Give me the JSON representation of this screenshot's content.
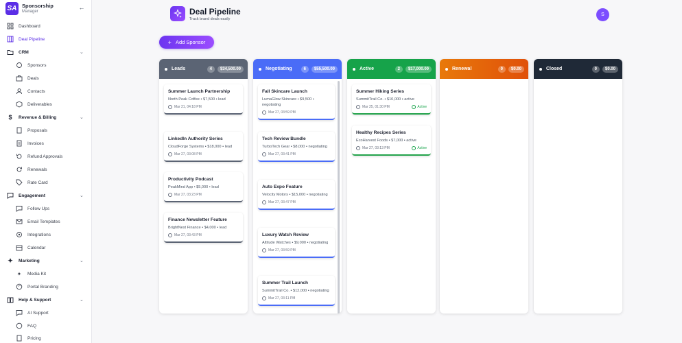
{
  "brand": {
    "logo": "SA",
    "title": "Sponsorship",
    "subtitle": "Manager",
    "collapse_icon": "chevron-left"
  },
  "nav": {
    "dashboard": "Dashboard",
    "deal_pipeline": "Deal Pipeline",
    "crm": "CRM",
    "sponsors": "Sponsors",
    "deals": "Deals",
    "contacts": "Contacts",
    "deliverables": "Deliverables",
    "revenue": "Revenue & Billing",
    "proposals": "Proposals",
    "invoices": "Invoices",
    "refund": "Refund Approvals",
    "renewals": "Renewals",
    "rate_card": "Rate Card",
    "engagement": "Engagement",
    "follow_ups": "Follow Ups",
    "email_templates": "Email Templates",
    "integrations": "Integrations",
    "calendar": "Calendar",
    "marketing": "Marketing",
    "media_kit": "Media Kit",
    "portal_branding": "Portal Branding",
    "help": "Help & Support",
    "ai_support": "AI Support",
    "faq": "FAQ",
    "pricing": "Pricing"
  },
  "header": {
    "title": "Deal Pipeline",
    "subtitle": "Track brand deals easily",
    "avatar": "S"
  },
  "add_button": {
    "label": "Add Sponsor"
  },
  "columns": {
    "leads": {
      "name": "Leads",
      "count": "4",
      "amount": "$34,500.00",
      "color": "#5b6474"
    },
    "negotiating": {
      "name": "Negotiating",
      "count": "6",
      "amount": "$55,500.00",
      "color": "#4a6cf7"
    },
    "active": {
      "name": "Active",
      "count": "2",
      "amount": "$17,000.00",
      "color": "#16a34a"
    },
    "renewal": {
      "name": "Renewal",
      "count": "0",
      "amount": "$0.00",
      "color": "#e8790a"
    },
    "closed": {
      "name": "Closed",
      "count": "0",
      "amount": "$0.00",
      "color": "#1f2937"
    }
  },
  "cards": {
    "leads": [
      {
        "title": "Summer Launch Partnership",
        "meta": "North Peak Coffee • $7,500 • lead",
        "date": "Mar 21, 04:18 PM"
      },
      {
        "title": "LinkedIn Authority Series",
        "meta": "CloudForge Systems • $18,000 • lead",
        "date": "Mar 27, 03:08 PM"
      },
      {
        "title": "Productivity Podcast",
        "meta": "PeakMind App • $5,000 • lead",
        "date": "Mar 27, 03:23 PM"
      },
      {
        "title": "Finance Newsletter Feature",
        "meta": "BrightNest Finance • $4,000 • lead",
        "date": "Mar 27, 03:43 PM"
      }
    ],
    "negotiating": [
      {
        "title": "Fall Skincare Launch",
        "meta": "LumaGlow Skincare • $9,500 • negotiating",
        "date": "Mar 27, 03:59 PM"
      },
      {
        "title": "Tech Review Bundle",
        "meta": "TurboTech Gear • $8,000 • negotiating",
        "date": "Mar 27, 03:41 PM"
      },
      {
        "title": "Auto Expo Feature",
        "meta": "Velocity Motors • $15,000 • negotiating",
        "date": "Mar 27, 03:47 PM"
      },
      {
        "title": "Luxury Watch Review",
        "meta": "Altitude Watches • $9,000 • negotiating",
        "date": "Mar 27, 03:59 PM"
      },
      {
        "title": "Summer Trail Launch",
        "meta": "SummitTrail Co. • $12,000 • negotiating",
        "date": "Mar 27, 03:11 PM"
      }
    ],
    "active": [
      {
        "title": "Summer Hiking Series",
        "meta": "SummitTrail Co. • $10,000 • active",
        "date": "Mar 25, 01:30 PM",
        "status": "Active"
      },
      {
        "title": "Healthy Recipes Series",
        "meta": "EcoHarvest Foods • $7,000 • active",
        "date": "Mar 27, 03:13 PM",
        "status": "Active"
      }
    ]
  }
}
